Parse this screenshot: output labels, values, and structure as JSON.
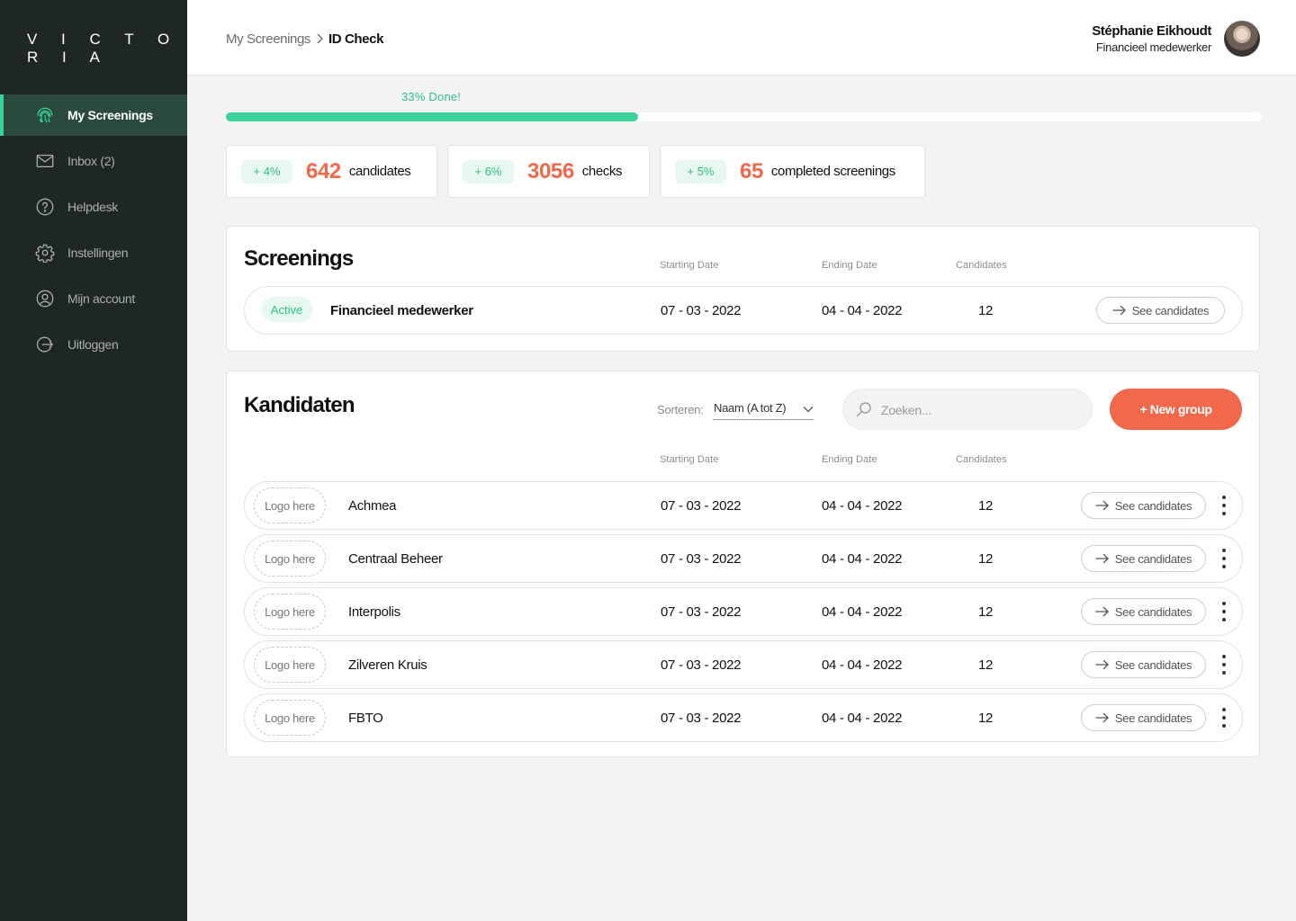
{
  "sidebar": {
    "logo": "V I C T O R I A",
    "items": [
      {
        "label": "My Screenings",
        "icon": "fingerprint-icon",
        "active": true
      },
      {
        "label": "Inbox (2)",
        "icon": "mail-icon"
      },
      {
        "label": "Helpdesk",
        "icon": "help-circle-icon"
      },
      {
        "label": "Instellingen",
        "icon": "gear-icon"
      },
      {
        "label": "Mijn account",
        "icon": "user-circle-icon"
      },
      {
        "label": "Uitloggen",
        "icon": "logout-icon"
      }
    ]
  },
  "header": {
    "breadcrumb": {
      "parent": "My Screenings",
      "separator": ">",
      "current": "ID Check"
    },
    "user": {
      "name": "Stéphanie Eikhoudt",
      "role": "Financieel medewerker"
    }
  },
  "progress": {
    "label": "33% Done!",
    "value": 0.398
  },
  "stats": [
    {
      "delta": "+ 4%",
      "value": "642",
      "label": "candidates"
    },
    {
      "delta": "+ 6%",
      "value": "3056",
      "label": "checks"
    },
    {
      "delta": "+ 5%",
      "value": "65",
      "label": "completed screenings"
    }
  ],
  "columns": {
    "start": "Starting Date",
    "end": "Ending Date",
    "candidates": "Candidates"
  },
  "screenings": {
    "title": "Screenings",
    "rows": [
      {
        "status": "Active",
        "name": "Financieel medewerker",
        "start": "07 - 03 - 2022",
        "end": "04 - 04 - 2022",
        "candidates": "12",
        "action": "See candidates"
      }
    ]
  },
  "kandidaten": {
    "title": "Kandidaten",
    "sort_label": "Sorteren:",
    "sort_value": "Naam (A tot Z)",
    "search_placeholder": "Zoeken...",
    "new_group_label": "+ New group",
    "logo_placeholder": "Logo here",
    "rows": [
      {
        "name": "Achmea",
        "start": "07 - 03 - 2022",
        "end": "04 - 04 - 2022",
        "candidates": "12",
        "action": "See candidates"
      },
      {
        "name": "Centraal Beheer",
        "start": "07 - 03 - 2022",
        "end": "04 - 04 - 2022",
        "candidates": "12",
        "action": "See candidates"
      },
      {
        "name": "Interpolis",
        "start": "07 - 03 - 2022",
        "end": "04 - 04 - 2022",
        "candidates": "12",
        "action": "See candidates"
      },
      {
        "name": "Zilveren Kruis",
        "start": "07 - 03 - 2022",
        "end": "04 - 04 - 2022",
        "candidates": "12",
        "action": "See candidates"
      },
      {
        "name": "FBTO",
        "start": "07 - 03 - 2022",
        "end": "04 - 04 - 2022",
        "candidates": "12",
        "action": "See candidates"
      }
    ]
  },
  "colors": {
    "accent_green": "#3ad39a",
    "accent_orange": "#f2684a",
    "sidebar_bg": "#1e2725",
    "sidebar_active": "#2b4a3e"
  }
}
